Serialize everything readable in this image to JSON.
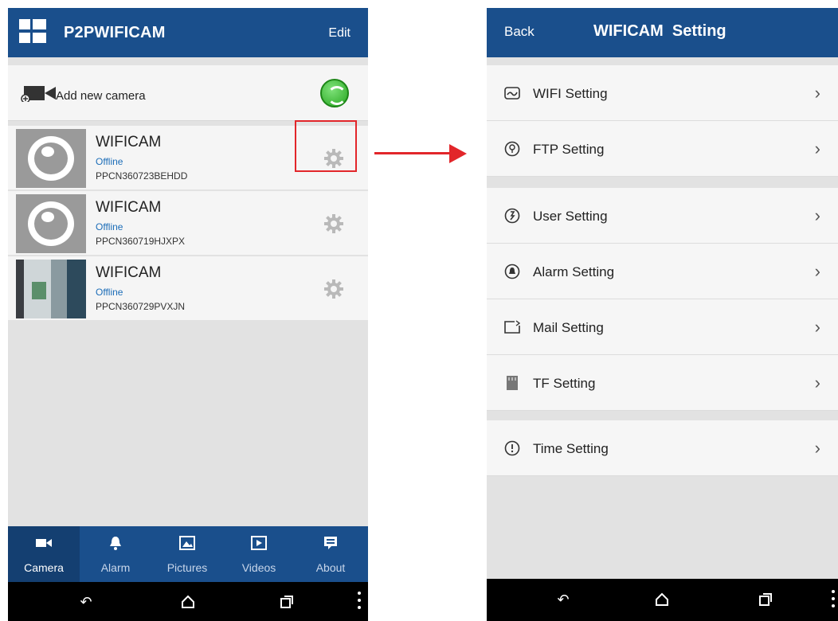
{
  "left_screen": {
    "header": {
      "title": "P2PWIFICAM",
      "edit_label": "Edit"
    },
    "add_camera": {
      "label": "Add new camera"
    },
    "cameras": [
      {
        "name": "WIFICAM",
        "status": "Offline",
        "id": "PPCN360723BEHDD"
      },
      {
        "name": "WIFICAM",
        "status": "Offline",
        "id": "PPCN360719HJXPX"
      },
      {
        "name": "WIFICAM",
        "status": "Offline",
        "id": "PPCN360729PVXJN"
      }
    ],
    "tabs": [
      {
        "label": "Camera",
        "icon": "camera-icon",
        "active": true
      },
      {
        "label": "Alarm",
        "icon": "bell-icon",
        "active": false
      },
      {
        "label": "Pictures",
        "icon": "image-icon",
        "active": false
      },
      {
        "label": "Videos",
        "icon": "video-icon",
        "active": false
      },
      {
        "label": "About",
        "icon": "message-icon",
        "active": false
      }
    ]
  },
  "right_screen": {
    "header": {
      "back_label": "Back",
      "title": "WIFICAM  Setting"
    },
    "settings": [
      {
        "label": "WIFI Setting",
        "icon": "wifi-icon"
      },
      {
        "label": "FTP Setting",
        "icon": "ftp-icon"
      },
      {
        "label": "User Setting",
        "icon": "user-icon"
      },
      {
        "label": "Alarm Setting",
        "icon": "alarm-icon"
      },
      {
        "label": "Mail Setting",
        "icon": "mail-icon"
      },
      {
        "label": "TF Setting",
        "icon": "sdcard-icon"
      },
      {
        "label": "Time Setting",
        "icon": "clock-icon"
      }
    ]
  },
  "colors": {
    "header_blue": "#1a4f8c",
    "highlight_red": "#e2262a",
    "status_blue": "#1c6db8"
  }
}
